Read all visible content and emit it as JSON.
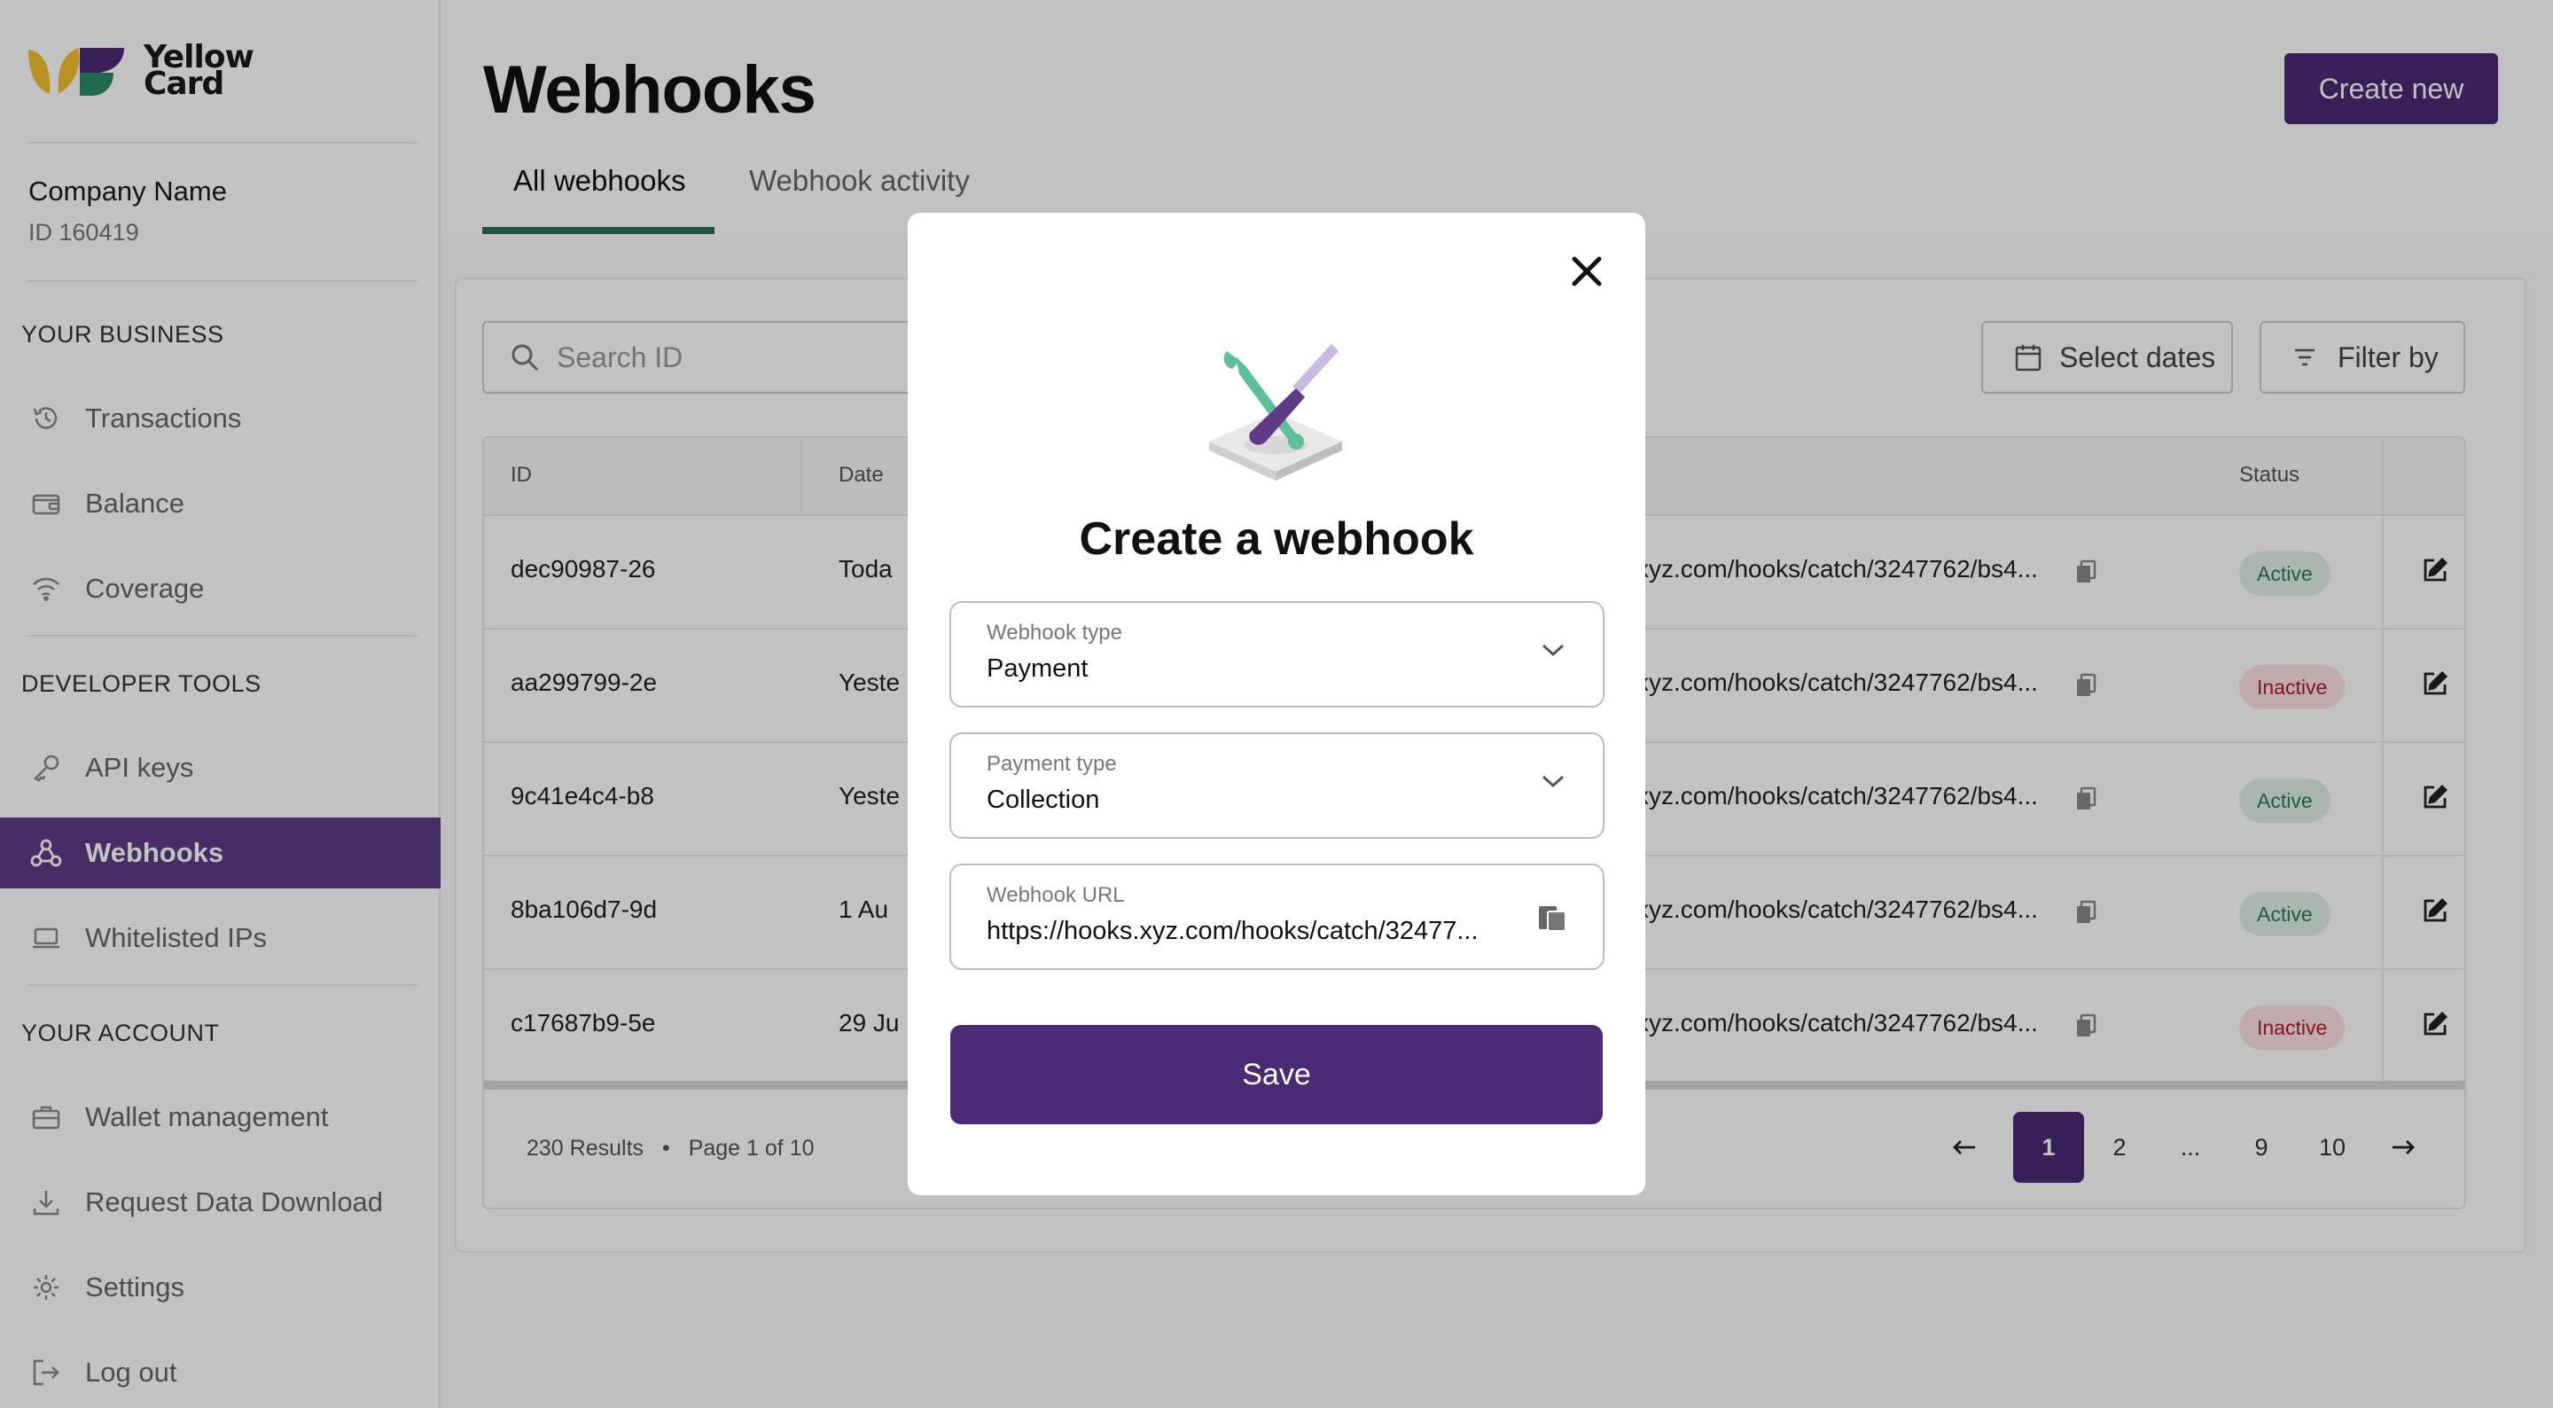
{
  "brand": {
    "name_line1": "Yellow",
    "name_line2": "Card"
  },
  "company": {
    "name": "Company Name",
    "id": "ID 160419"
  },
  "sidebar": {
    "sections": [
      "YOUR BUSINESS",
      "DEVELOPER TOOLS",
      "YOUR ACCOUNT"
    ],
    "items": [
      {
        "label": "Transactions",
        "icon": "history-icon"
      },
      {
        "label": "Balance",
        "icon": "wallet-icon"
      },
      {
        "label": "Coverage",
        "icon": "wifi-icon"
      },
      {
        "label": "API keys",
        "icon": "key-icon"
      },
      {
        "label": "Webhooks",
        "icon": "webhook-icon",
        "active": true
      },
      {
        "label": "Whitelisted IPs",
        "icon": "laptop-icon"
      },
      {
        "label": "Wallet management",
        "icon": "briefcase-icon"
      },
      {
        "label": "Request Data Download",
        "icon": "download-icon"
      },
      {
        "label": "Settings",
        "icon": "gear-icon"
      },
      {
        "label": "Log out",
        "icon": "logout-icon"
      }
    ]
  },
  "header": {
    "title": "Webhooks",
    "create_label": "Create new",
    "tabs": [
      {
        "label": "All webhooks",
        "active": true
      },
      {
        "label": "Webhook activity"
      }
    ]
  },
  "toolbar": {
    "search_placeholder": "Search ID",
    "dates_label": "Select dates",
    "filter_label": "Filter by"
  },
  "table": {
    "headers": {
      "id": "ID",
      "date": "Date",
      "status": "Status"
    },
    "rows": [
      {
        "id": "dec90987-26",
        "date": "Toda",
        "url": "xyz.com/hooks/catch/3247762/bs4...",
        "status": "Active"
      },
      {
        "id": "aa299799-2e",
        "date": "Yeste",
        "url": "xyz.com/hooks/catch/3247762/bs4...",
        "status": "Inactive"
      },
      {
        "id": "9c41e4c4-b8",
        "date": "Yeste",
        "url": "xyz.com/hooks/catch/3247762/bs4...",
        "status": "Active"
      },
      {
        "id": "8ba106d7-9d",
        "date": "1 Au",
        "url": "xyz.com/hooks/catch/3247762/bs4...",
        "status": "Active"
      },
      {
        "id": "c17687b9-5e",
        "date": "29 Ju",
        "url": "xyz.com/hooks/catch/3247762/bs4...",
        "status": "Inactive"
      }
    ]
  },
  "pagination": {
    "results": "230 Results",
    "page_text": "Page 1 of 10",
    "pages": [
      "1",
      "2",
      "...",
      "9",
      "10"
    ],
    "current": "1"
  },
  "modal": {
    "title": "Create a webhook",
    "fields": [
      {
        "label": "Webhook type",
        "value": "Payment"
      },
      {
        "label": "Payment type",
        "value": "Collection"
      },
      {
        "label": "Webhook URL",
        "value": "https://hooks.xyz.com/hooks/catch/32477..."
      }
    ],
    "save_label": "Save"
  },
  "colors": {
    "primary": "#4a2a74",
    "accent_green": "#2c6e55",
    "active_badge": "#2b7a55",
    "inactive_badge": "#b0192b"
  }
}
